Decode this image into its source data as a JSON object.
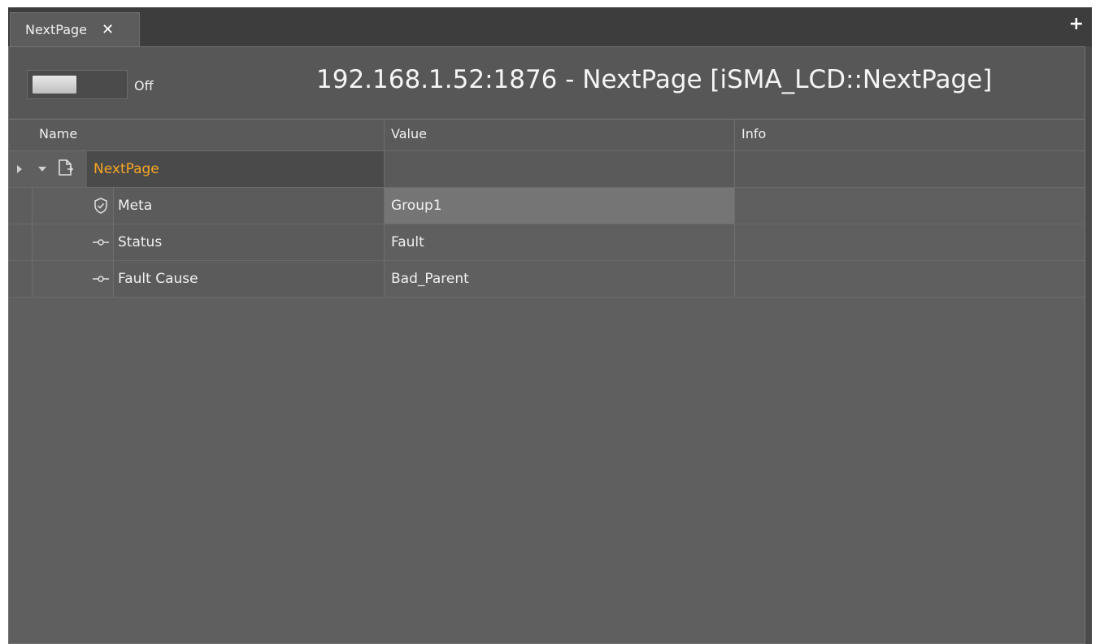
{
  "tabs": [
    {
      "label": "NextPage",
      "close_glyph": "✕"
    }
  ],
  "add_tab_glyph": "+",
  "toggle": {
    "state_label": "Off",
    "on": false
  },
  "header": {
    "title": "192.168.1.52:1876 - NextPage [iSMA_LCD::NextPage]"
  },
  "table": {
    "columns": [
      "Name",
      "Value",
      "Info"
    ],
    "root": {
      "name": "NextPage",
      "value": "",
      "info": "",
      "icon": "page-link-icon",
      "name_color": "#f5a623"
    },
    "rows": [
      {
        "name": "Meta",
        "value": "Group1",
        "info": "",
        "icon": "shield-check-icon"
      },
      {
        "name": "Status",
        "value": "Fault",
        "info": "",
        "icon": "slot-icon"
      },
      {
        "name": "Fault Cause",
        "value": "Bad_Parent",
        "info": "",
        "icon": "slot-icon"
      }
    ]
  }
}
